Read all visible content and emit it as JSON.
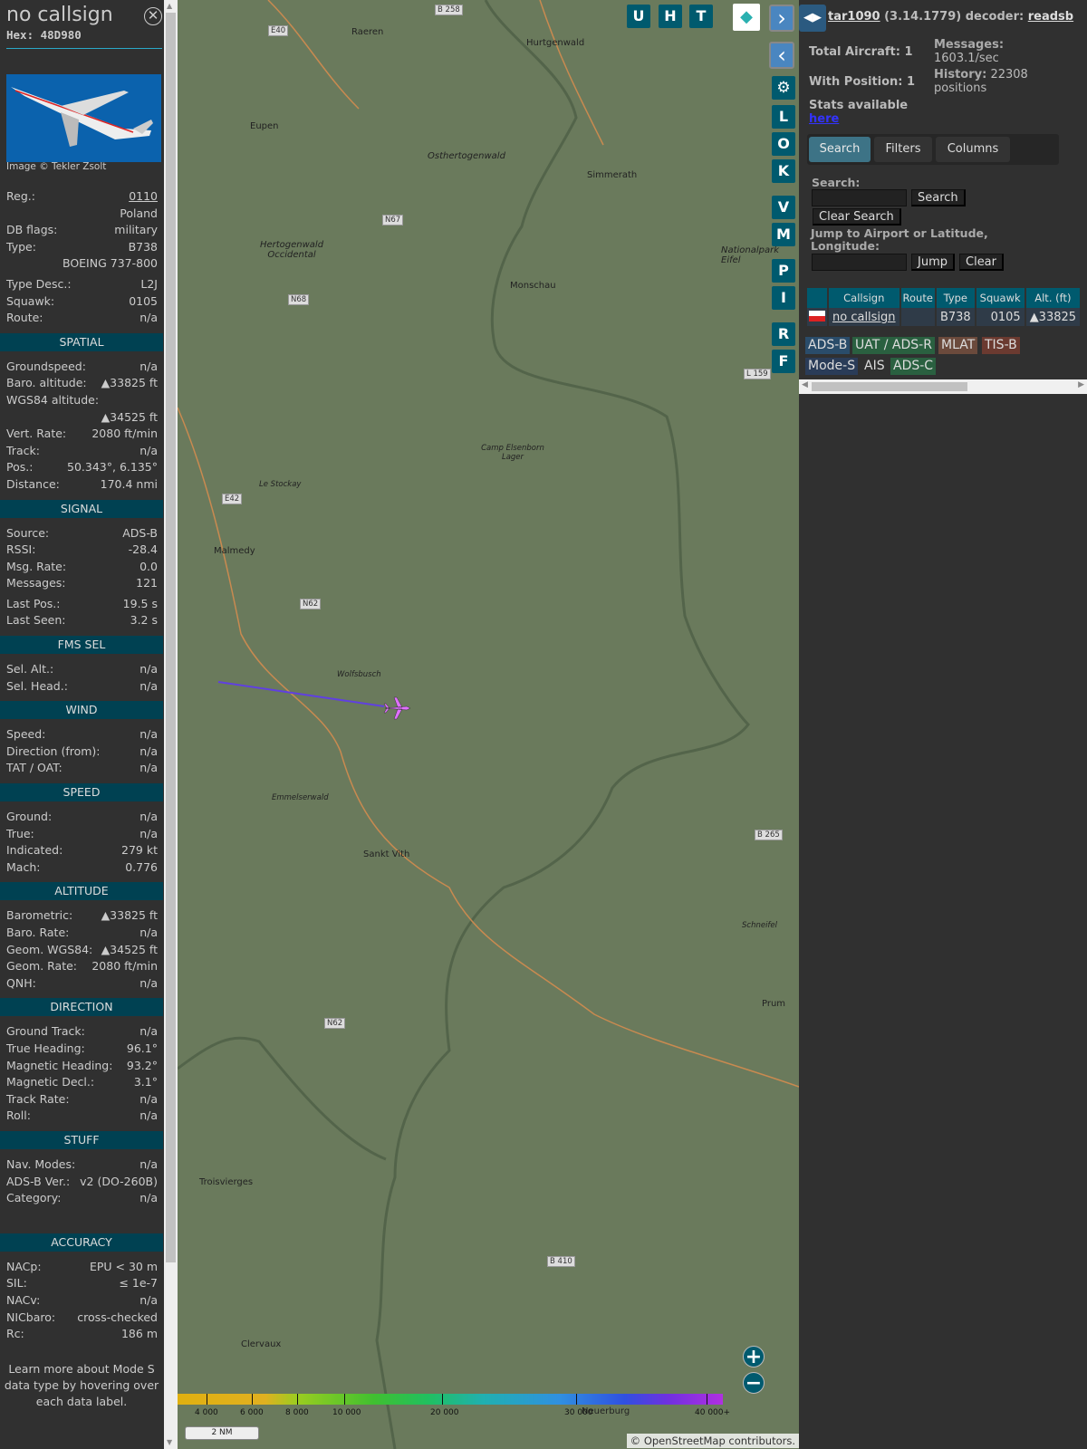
{
  "sidebar": {
    "title": "no callsign",
    "hex": "Hex: 48D980",
    "image_credit": "Image © Tekler Zsolt",
    "basic": [
      {
        "l": "Reg.:",
        "v": "0110"
      },
      {
        "l": "",
        "v": "Poland"
      },
      {
        "l": "DB flags:",
        "v": "military"
      },
      {
        "l": "Type:",
        "v": "B738"
      },
      {
        "l": "",
        "v": "BOEING 737-800"
      },
      {
        "l": "Type Desc.:",
        "v": "L2J"
      },
      {
        "l": "Squawk:",
        "v": "0105"
      },
      {
        "l": "Route:",
        "v": "n/a"
      }
    ],
    "sections": [
      {
        "title": "SPATIAL",
        "rows": [
          {
            "l": "Groundspeed:",
            "v": "n/a"
          },
          {
            "l": "Baro. altitude:",
            "v": "▲33825 ft"
          },
          {
            "l": "WGS84 altitude:",
            "v": ""
          },
          {
            "l": "",
            "v": "▲34525 ft"
          },
          {
            "l": "Vert. Rate:",
            "v": "2080 ft/min"
          },
          {
            "l": "Track:",
            "v": "n/a"
          },
          {
            "l": "Pos.:",
            "v": "50.343°, 6.135°"
          },
          {
            "l": "Distance:",
            "v": "170.4 nmi"
          }
        ]
      },
      {
        "title": "SIGNAL",
        "rows": [
          {
            "l": "Source:",
            "v": "ADS-B"
          },
          {
            "l": "RSSI:",
            "v": "-28.4"
          },
          {
            "l": "Msg. Rate:",
            "v": "0.0"
          },
          {
            "l": "Messages:",
            "v": "121"
          },
          {
            "l": "Last Pos.:",
            "v": "19.5 s"
          },
          {
            "l": "Last Seen:",
            "v": "3.2 s"
          }
        ]
      },
      {
        "title": "FMS SEL",
        "rows": [
          {
            "l": "Sel. Alt.:",
            "v": "n/a"
          },
          {
            "l": "Sel. Head.:",
            "v": "n/a"
          }
        ]
      },
      {
        "title": "WIND",
        "rows": [
          {
            "l": "Speed:",
            "v": "n/a"
          },
          {
            "l": "Direction (from):",
            "v": "n/a"
          },
          {
            "l": "TAT / OAT:",
            "v": "n/a"
          }
        ]
      },
      {
        "title": "SPEED",
        "rows": [
          {
            "l": "Ground:",
            "v": "n/a"
          },
          {
            "l": "True:",
            "v": "n/a"
          },
          {
            "l": "Indicated:",
            "v": "279 kt"
          },
          {
            "l": "Mach:",
            "v": "0.776"
          }
        ]
      },
      {
        "title": "ALTITUDE",
        "rows": [
          {
            "l": "Barometric:",
            "v": "▲33825 ft"
          },
          {
            "l": "Baro. Rate:",
            "v": "n/a"
          },
          {
            "l": "Geom. WGS84:",
            "v": "▲34525 ft"
          },
          {
            "l": "Geom. Rate:",
            "v": "2080 ft/min"
          },
          {
            "l": "QNH:",
            "v": "n/a"
          }
        ]
      },
      {
        "title": "DIRECTION",
        "rows": [
          {
            "l": "Ground Track:",
            "v": "n/a"
          },
          {
            "l": "True Heading:",
            "v": "96.1°"
          },
          {
            "l": "Magnetic Heading:",
            "v": "93.2°"
          },
          {
            "l": "Magnetic Decl.:",
            "v": "3.1°"
          },
          {
            "l": "Track Rate:",
            "v": "n/a"
          },
          {
            "l": "Roll:",
            "v": "n/a"
          }
        ]
      },
      {
        "title": "STUFF",
        "rows": [
          {
            "l": "Nav. Modes:",
            "v": "n/a"
          },
          {
            "l": "ADS-B Ver.:",
            "v": "v2 (DO-260B)"
          },
          {
            "l": "Category:",
            "v": "n/a"
          }
        ]
      },
      {
        "title": "ACCURACY",
        "rows": [
          {
            "l": "NACp:",
            "v": "EPU < 30 m"
          },
          {
            "l": "SIL:",
            "v": "≤ 1e-7"
          },
          {
            "l": "NACv:",
            "v": "n/a"
          },
          {
            "l": "NICbaro:",
            "v": "cross-checked"
          },
          {
            "l": "Rc:",
            "v": "186 m"
          }
        ]
      }
    ],
    "footer": "Learn more about Mode S data type by hovering over each data label."
  },
  "map": {
    "top_buttons": [
      "U",
      "H",
      "T"
    ],
    "side_buttons": [
      "L",
      "O",
      "K",
      "V",
      "M",
      "P",
      "I",
      "R",
      "F"
    ],
    "places": [
      {
        "name": "Raeren"
      },
      {
        "name": "Eupen"
      },
      {
        "name": "Hurtgenwald"
      },
      {
        "name": "Osthertogenwald"
      },
      {
        "name": "Simmerath"
      },
      {
        "name": "Hertogenwald Occidental"
      },
      {
        "name": "Monschau"
      },
      {
        "name": "Nationalpark Eifel"
      },
      {
        "name": "Camp Elsenborn Lager"
      },
      {
        "name": "Le Stockay"
      },
      {
        "name": "Malmedy"
      },
      {
        "name": "Wolfsbusch"
      },
      {
        "name": "Emmelserwald"
      },
      {
        "name": "Sankt Vith"
      },
      {
        "name": "Schneifel"
      },
      {
        "name": "Prum"
      },
      {
        "name": "Troisvierges"
      },
      {
        "name": "Clervaux"
      },
      {
        "name": "Neuerburg"
      }
    ],
    "roads": [
      "B 258",
      "E40",
      "N67",
      "N68",
      "L 159",
      "E42",
      "N62",
      "B 265",
      "N62",
      "B 410"
    ],
    "legend_labels": [
      "4 000",
      "6 000",
      "8 000",
      "10 000",
      "20 000",
      "30 000",
      "40 000+"
    ],
    "scale": "2 NM",
    "attribution": "© OpenStreetMap contributors."
  },
  "panel": {
    "version_prefix": "tar1090",
    "version": " (3.14.1779) decoder: ",
    "decoder": "readsb",
    "total_aircraft": "Total Aircraft: 1",
    "with_position": "With Position: 1",
    "messages_label": "Messages:",
    "messages": "1603.1/sec",
    "history_label": "History:",
    "history": " 22308 positions",
    "stats": "Stats available",
    "stats_link": "here",
    "tabs": [
      "Search",
      "Filters",
      "Columns"
    ],
    "search_label": "Search:",
    "search_btn": "Search",
    "clear_search": "Clear Search",
    "jump_label": "Jump to Airport or Latitude, Longitude:",
    "jump_btn": "Jump",
    "clear_btn": "Clear",
    "table": {
      "headers": [
        "",
        "Callsign",
        "Route",
        "Type",
        "Squawk",
        "Alt. (ft)"
      ],
      "rows": [
        {
          "callsign": "no callsign",
          "route": "",
          "type": "B738",
          "squawk": "0105",
          "alt": "▲33825"
        }
      ]
    },
    "badges": [
      "ADS-B",
      "UAT / ADS-R",
      "MLAT",
      "TIS-B",
      "Mode-S",
      "AIS",
      "ADS-C"
    ]
  },
  "colors": {
    "header": "#004152",
    "button": "#005a6e",
    "adsb": "#2a4c6a",
    "uat": "#2a6040",
    "mlat": "#6b4a3c"
  }
}
